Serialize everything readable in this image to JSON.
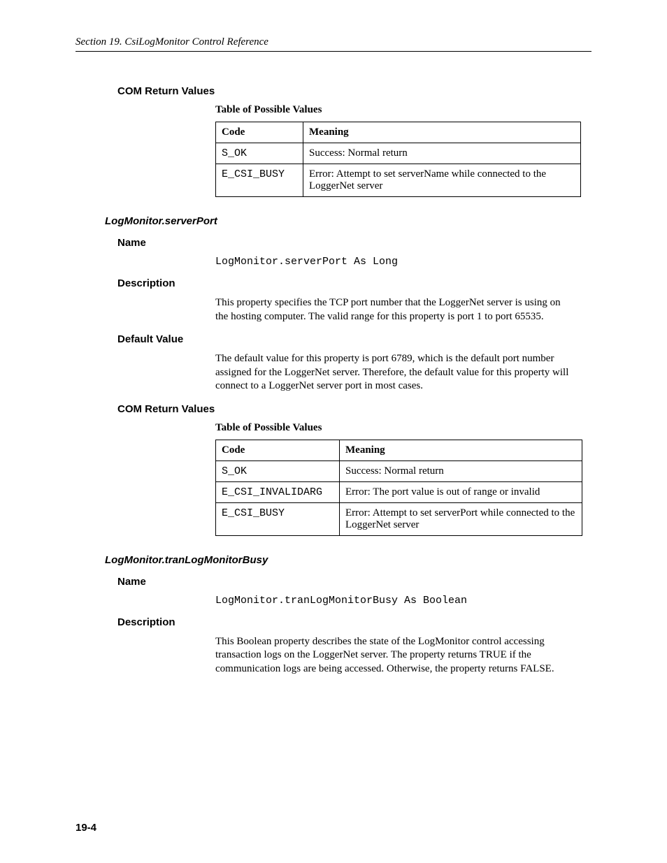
{
  "header": "Section 19.  CsiLogMonitor Control Reference",
  "page_number": "19-4",
  "section1": {
    "heading": "COM Return Values",
    "caption": "Table of Possible Values",
    "th_code": "Code",
    "th_meaning": "Meaning",
    "rows": [
      {
        "code": "S_OK",
        "meaning": "Success: Normal return"
      },
      {
        "code": "E_CSI_BUSY",
        "meaning": "Error: Attempt to set serverName while connected to the LoggerNet server"
      }
    ]
  },
  "prop1": {
    "title": "LogMonitor.serverPort",
    "name_heading": "Name",
    "name_code": "LogMonitor.serverPort As Long",
    "desc_heading": "Description",
    "desc_text": "This property specifies the TCP port number that the LoggerNet server is using on the hosting computer.  The valid range for this property is port 1 to port 65535.",
    "default_heading": "Default Value",
    "default_text": "The default value for this property is port 6789, which is the default port number assigned for the LoggerNet server.  Therefore, the default value for this property will connect to a LoggerNet server port in most cases.",
    "com_heading": "COM Return Values",
    "caption": "Table of Possible Values",
    "th_code": "Code",
    "th_meaning": "Meaning",
    "rows": [
      {
        "code": "S_OK",
        "meaning": "Success: Normal return"
      },
      {
        "code": "E_CSI_INVALIDARG",
        "meaning": "Error: The port value is out of range or invalid"
      },
      {
        "code": "E_CSI_BUSY",
        "meaning": "Error: Attempt to set serverPort while connected to the LoggerNet server"
      }
    ]
  },
  "prop2": {
    "title": "LogMonitor.tranLogMonitorBusy",
    "name_heading": "Name",
    "name_code": "LogMonitor.tranLogMonitorBusy As Boolean",
    "desc_heading": "Description",
    "desc_text": "This Boolean property describes the state of the LogMonitor control accessing transaction logs on the LoggerNet server.  The property returns TRUE if the communication logs are being accessed.  Otherwise, the property returns FALSE."
  }
}
